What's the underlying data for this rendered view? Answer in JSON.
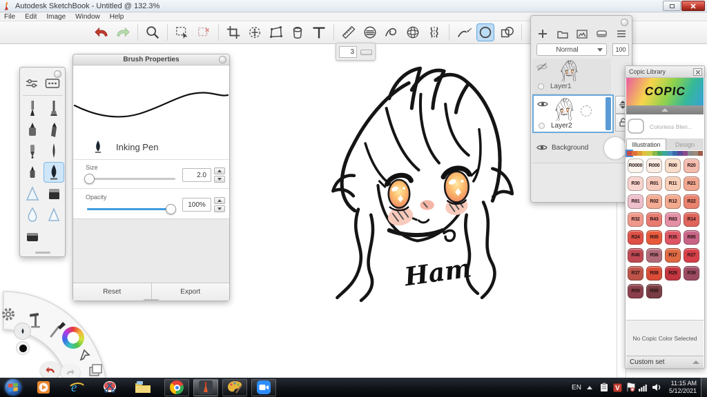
{
  "window": {
    "title": "Autodesk SketchBook - Untitled @ 132.3%"
  },
  "menu": {
    "items": [
      "File",
      "Edit",
      "Image",
      "Window",
      "Help"
    ]
  },
  "toolbar": {
    "tools": [
      "undo",
      "redo",
      "zoom",
      "select",
      "deselect",
      "crop",
      "transform",
      "distort",
      "fill",
      "text",
      "ruler",
      "ellipse-guide",
      "french-curve",
      "perspective",
      "symmetry",
      "steady-stroke",
      "ellipse",
      "shapes",
      "layer-editor",
      "brush-library",
      "color-editor"
    ],
    "selected_tool": "ellipse"
  },
  "size_hud": {
    "value": "3"
  },
  "brush_panel": {
    "title": "Brush Properties",
    "brush_name": "Inking Pen",
    "size_label": "Size",
    "size_value": "2.0",
    "opacity_label": "Opacity",
    "opacity_value": "100%",
    "reset_label": "Reset",
    "export_label": "Export"
  },
  "left_toolbar": {
    "tools": [
      "pencil",
      "paintbrush",
      "marker",
      "chisel-marker",
      "ballpoint-pen",
      "fine-brush",
      "felt-pen",
      "inking-pen",
      "airbrush",
      "flat-marker",
      "water-drop",
      "smear",
      "block-eraser"
    ],
    "selected": "inking-pen"
  },
  "layers_panel": {
    "blend_mode": "Normal",
    "opacity": "100",
    "layers": [
      {
        "name": "Layer1",
        "visible": false,
        "selected": false
      },
      {
        "name": "Layer2",
        "visible": true,
        "selected": true
      },
      {
        "name": "Background",
        "visible": true,
        "selected": false
      }
    ]
  },
  "copic_panel": {
    "title": "Copic Library",
    "logo": "COPIC",
    "blender_label": "Colorless Blen...",
    "tabs": [
      {
        "label": "Illustration",
        "active": true
      },
      {
        "label": "Design",
        "active": false
      }
    ],
    "strip_selected": 0,
    "strip_colors": [
      "#c84a45",
      "#e0703a",
      "#e09a3a",
      "#e0c040",
      "#c8cc48",
      "#8ab84a",
      "#4aa85c",
      "#3aa89a",
      "#4a90c0",
      "#3a6aaa",
      "#5a4a9a",
      "#8a4a8a",
      "#888888",
      "#9a8a7a",
      "#a05a4a"
    ],
    "swatches": [
      {
        "code": "R0000",
        "color": "#fdf5ef"
      },
      {
        "code": "R000",
        "color": "#fceee4"
      },
      {
        "code": "R00",
        "color": "#f8ddc9"
      },
      {
        "code": "R20",
        "color": "#f4bcae"
      },
      {
        "code": "R30",
        "color": "#f9d4ce"
      },
      {
        "code": "R01",
        "color": "#f6c9ba"
      },
      {
        "code": "R11",
        "color": "#f8cfb8"
      },
      {
        "code": "R21",
        "color": "#f1a78f"
      },
      {
        "code": "R81",
        "color": "#eec0cc"
      },
      {
        "code": "R02",
        "color": "#f3ab92"
      },
      {
        "code": "R12",
        "color": "#f2a98e"
      },
      {
        "code": "R22",
        "color": "#e9826e"
      },
      {
        "code": "R32",
        "color": "#f0998a"
      },
      {
        "code": "R43",
        "color": "#e87a70"
      },
      {
        "code": "R83",
        "color": "#e48fa6"
      },
      {
        "code": "R14",
        "color": "#e0655b"
      },
      {
        "code": "R24",
        "color": "#de4f45"
      },
      {
        "code": "R05",
        "color": "#e8593a"
      },
      {
        "code": "R35",
        "color": "#de5564"
      },
      {
        "code": "R85",
        "color": "#c96487"
      },
      {
        "code": "R46",
        "color": "#bf4853"
      },
      {
        "code": "R56",
        "color": "#b26b79"
      },
      {
        "code": "R17",
        "color": "#e06a42"
      },
      {
        "code": "R27",
        "color": "#d73f49"
      },
      {
        "code": "R37",
        "color": "#bd5348"
      },
      {
        "code": "R08",
        "color": "#da4c36"
      },
      {
        "code": "R29",
        "color": "#c4353f"
      },
      {
        "code": "R39",
        "color": "#9c4a62"
      },
      {
        "code": "R59",
        "color": "#8b3e4b"
      },
      {
        "code": "R89",
        "color": "#783c42"
      }
    ],
    "no_color_text": "No Copic Color Selected",
    "custom_set_label": "Custom set"
  },
  "canvas": {
    "signature": "Ham"
  },
  "taskbar": {
    "language": "EN",
    "time": "11:15 AM",
    "date": "5/12/2021"
  }
}
